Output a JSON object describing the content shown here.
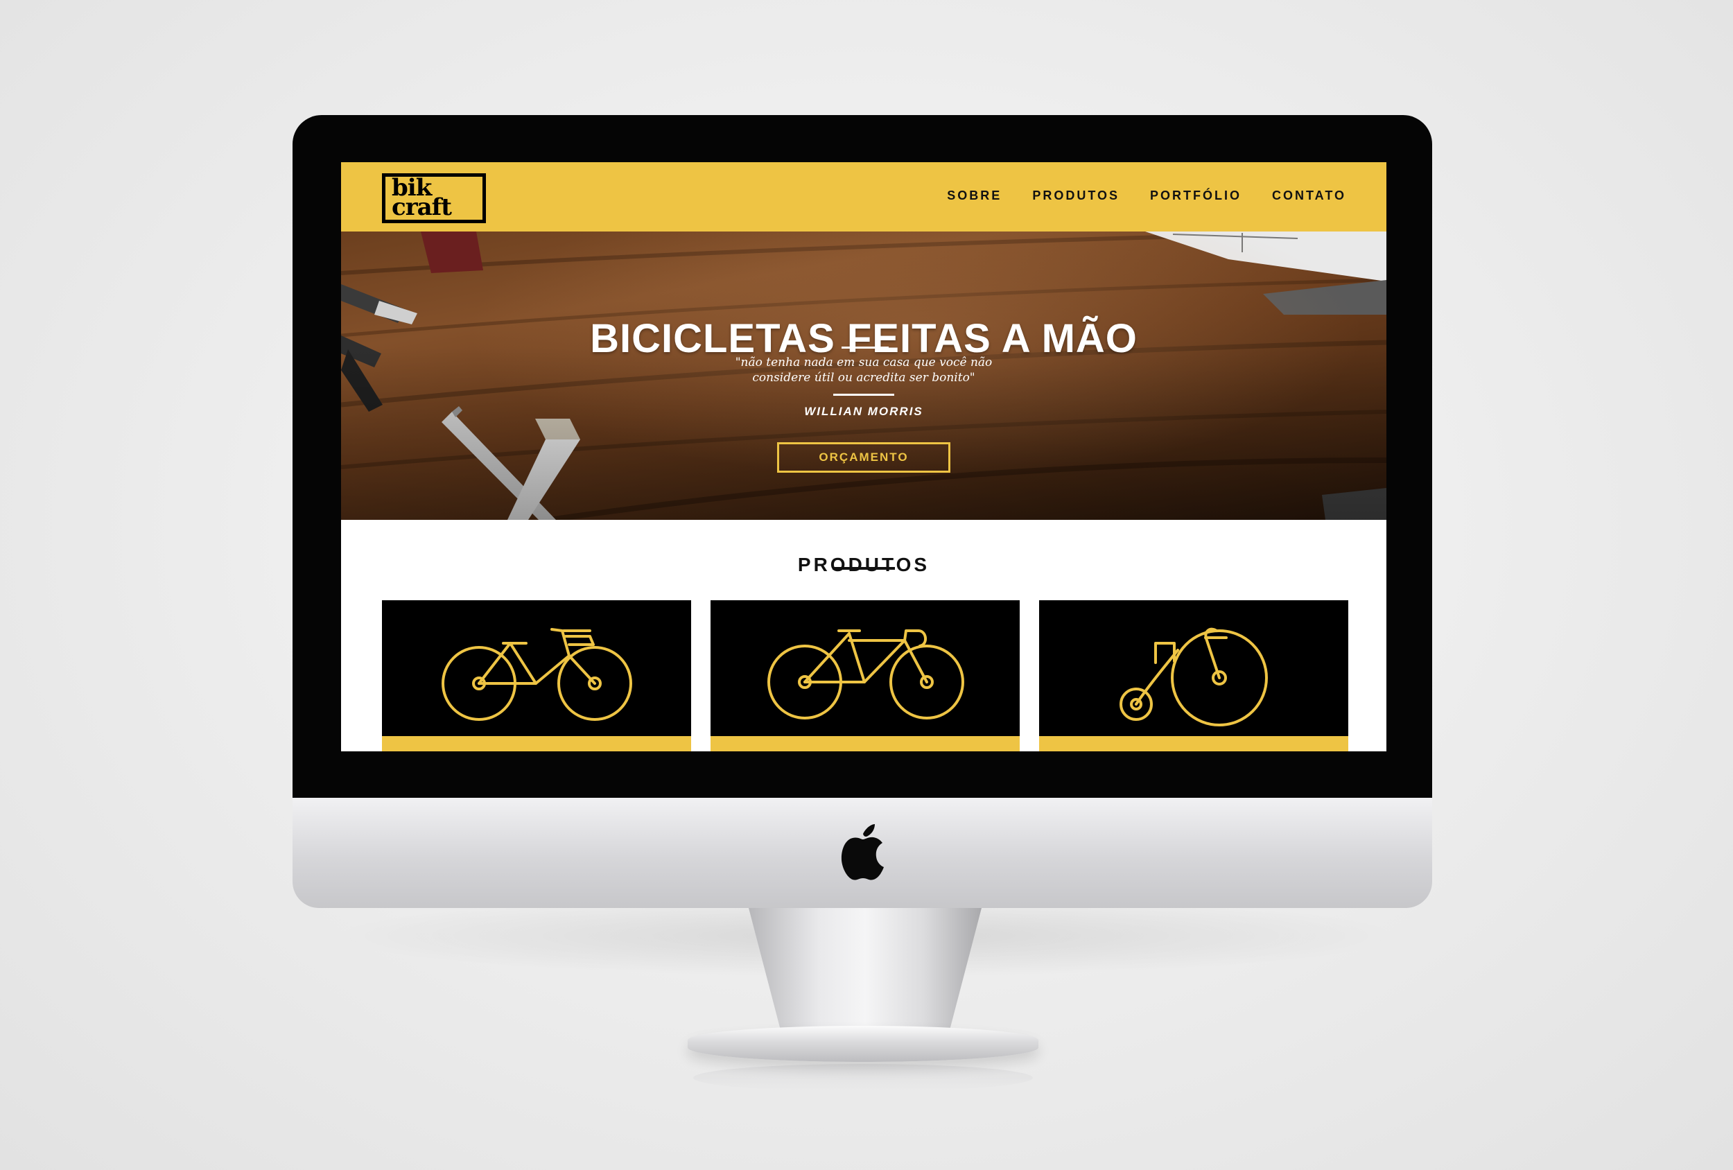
{
  "site": {
    "logo": {
      "line1": "bik",
      "line2": "craft"
    },
    "nav": [
      {
        "label": "SOBRE"
      },
      {
        "label": "PRODUTOS"
      },
      {
        "label": "PORTFÓLIO"
      },
      {
        "label": "CONTATO"
      }
    ],
    "hero": {
      "title": "BICICLETAS FEITAS A MÃO",
      "quote_line1": "\"não tenha nada em sua casa que você não",
      "quote_line2": "considere útil ou acredita ser bonito\"",
      "author": "WILLIAN MORRIS",
      "button_label": "ORÇAMENTO"
    },
    "products": {
      "title": "PRODUTOS",
      "items": [
        {
          "icon": "city-bike-icon"
        },
        {
          "icon": "road-bike-icon"
        },
        {
          "icon": "penny-farthing-icon"
        }
      ]
    }
  },
  "colors": {
    "accent": "#eec444",
    "dark": "#000000",
    "text_light": "#ffffff"
  }
}
